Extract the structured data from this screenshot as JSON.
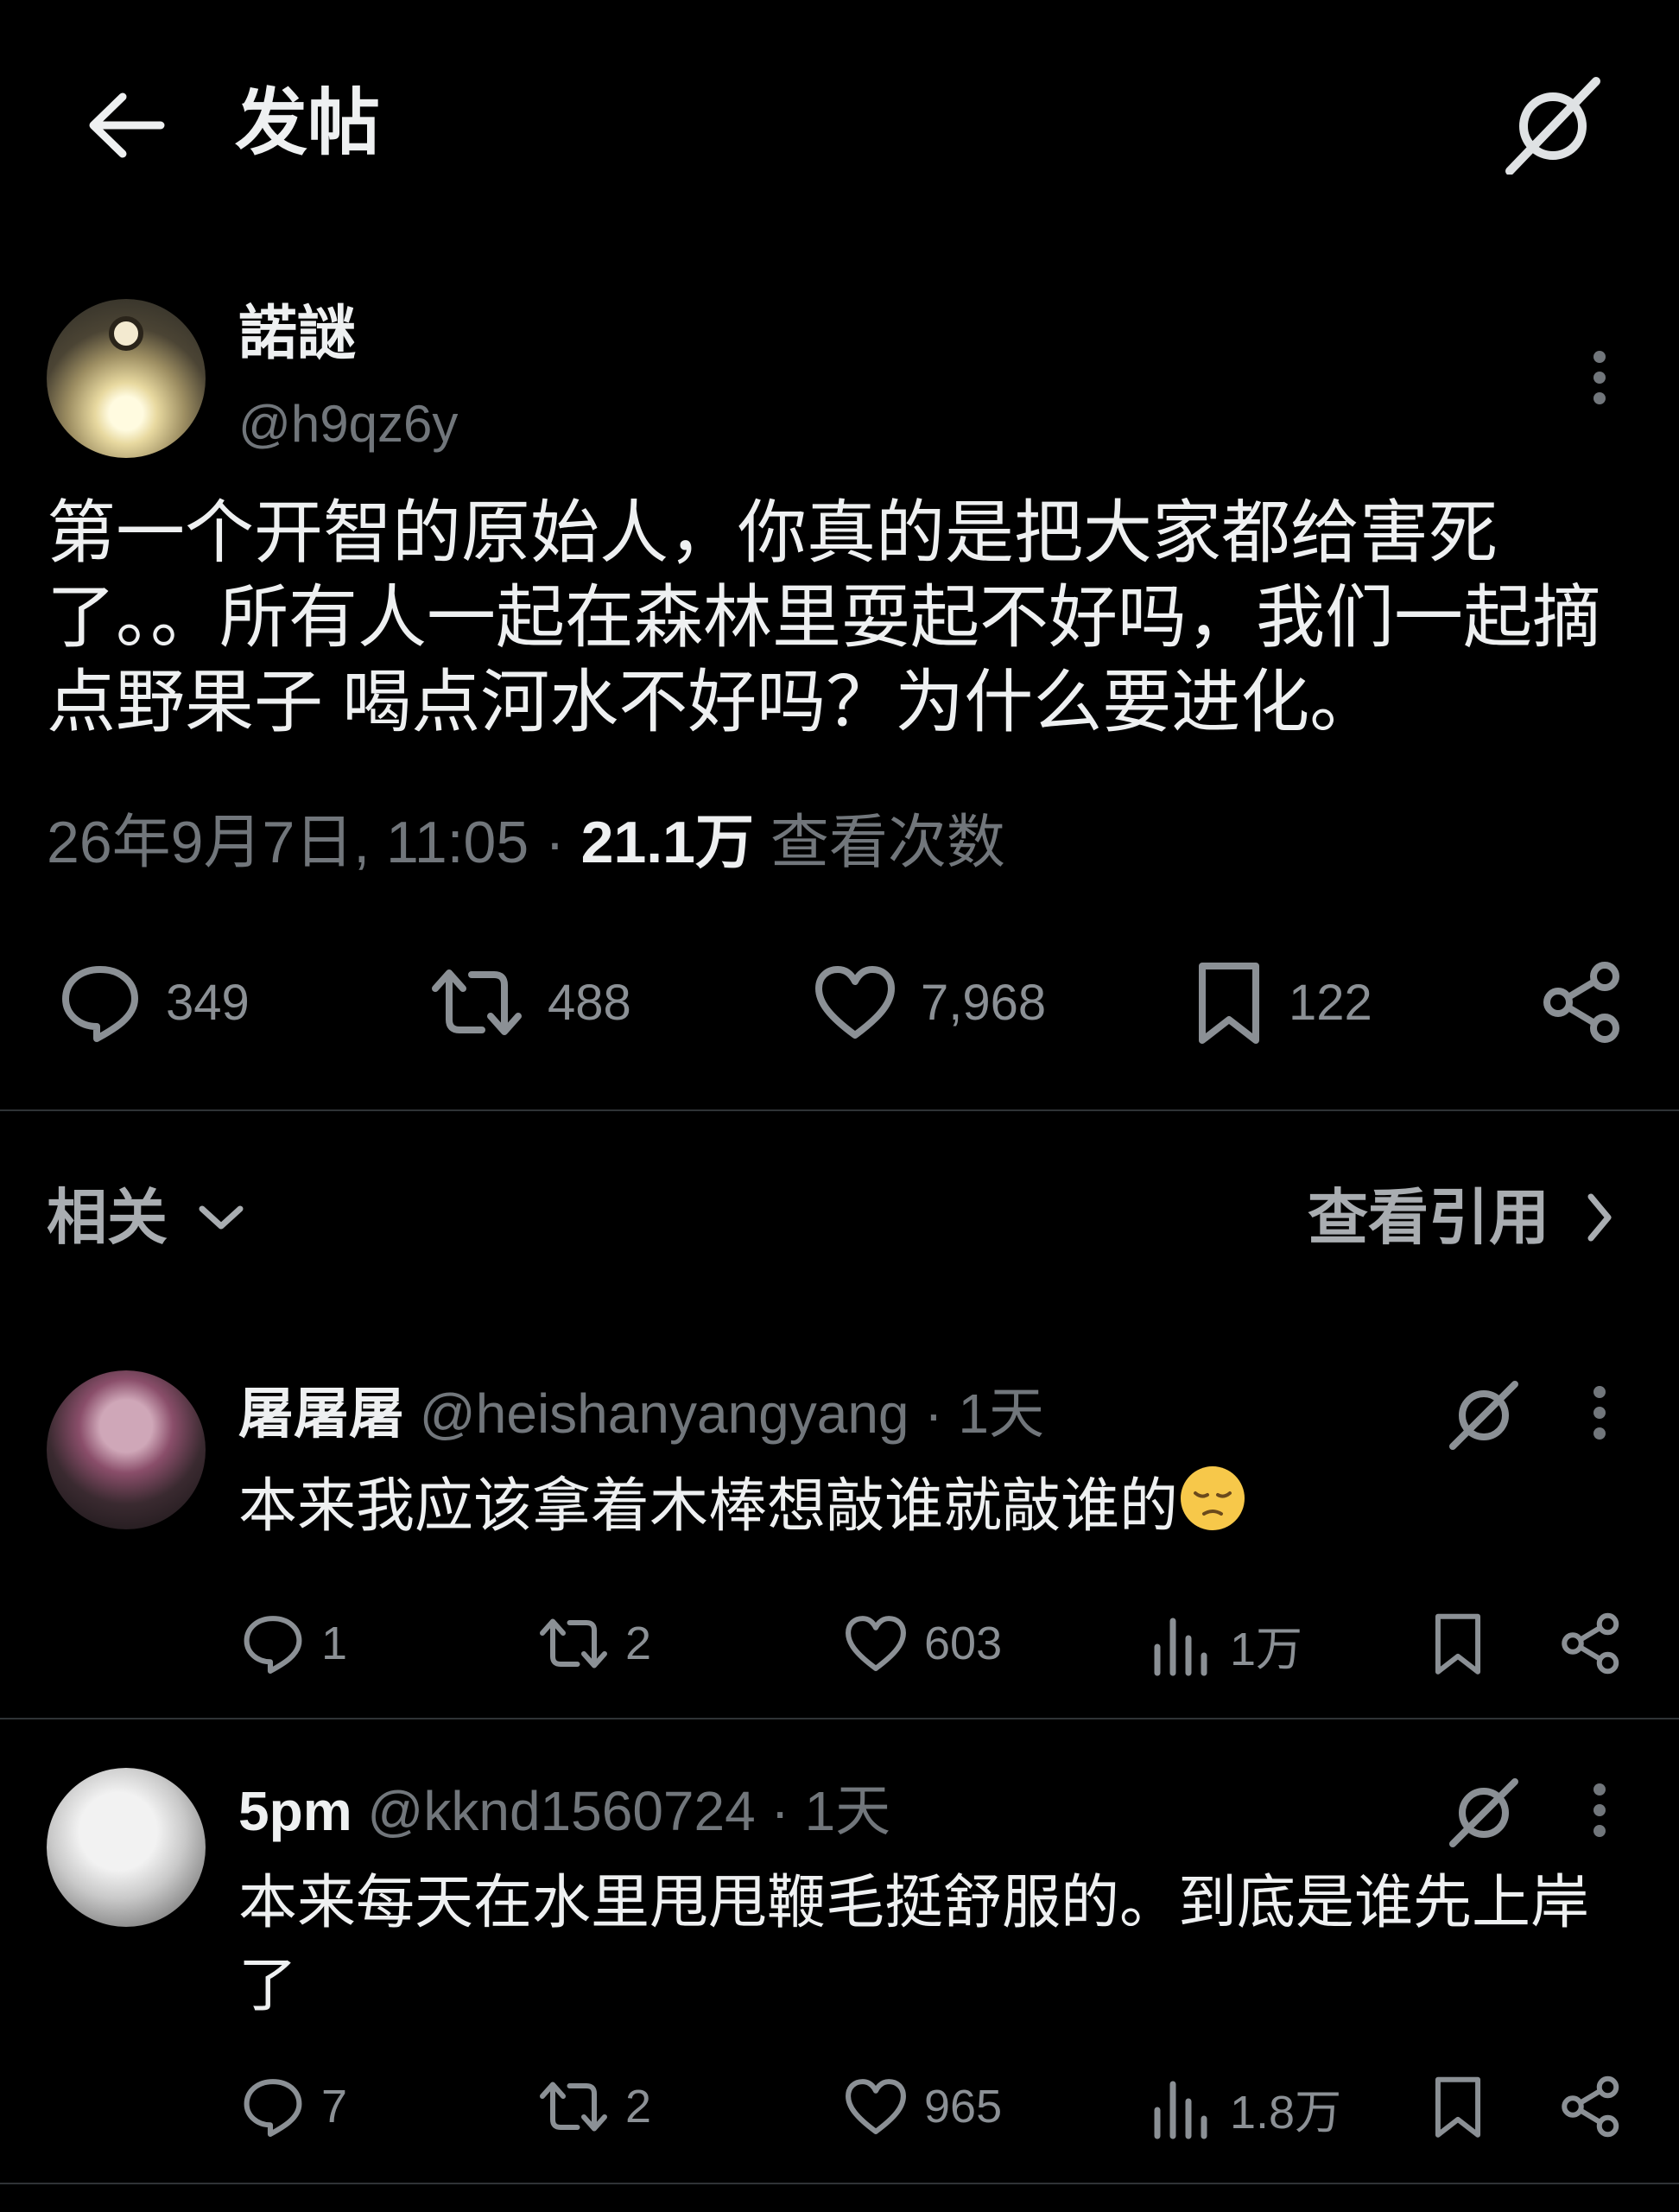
{
  "header": {
    "title": "发帖"
  },
  "post": {
    "display_name": "諾謎",
    "handle": "@h9qz6y",
    "text": "第一个开智的原始人，你真的是把大家都给害死了。。所有人一起在森林里耍起不好吗，我们一起摘点野果子 喝点河水不好吗？为什么要进化。",
    "date": "26年9月7日, 11:05",
    "separator": "·",
    "views_count": "21.1万",
    "views_label": "查看次数",
    "replies": "349",
    "reposts": "488",
    "likes": "7,968",
    "bookmarks": "122"
  },
  "related": {
    "label": "相关",
    "quotes_label": "查看引用"
  },
  "replies": [
    {
      "display_name": "屠屠屠",
      "handle": "@heishanyangyang",
      "dot": "·",
      "time": "1天",
      "text": "本来我应该拿着木棒想敲谁就敲谁的",
      "emoji": "pensive-face",
      "replies": "1",
      "reposts": "2",
      "likes": "603",
      "views": "1万"
    },
    {
      "display_name": "5pm",
      "handle": "@kknd1560724",
      "dot": "·",
      "time": "1天",
      "text": "本来每天在水里甩甩鞭毛挺舒服的。到底是谁先上岸了",
      "replies": "7",
      "reposts": "2",
      "likes": "965",
      "views": "1.8万"
    }
  ],
  "colors": {
    "background": "#000000",
    "text": "#e7e9ea",
    "muted": "#71767b",
    "divider": "#2f3336"
  }
}
